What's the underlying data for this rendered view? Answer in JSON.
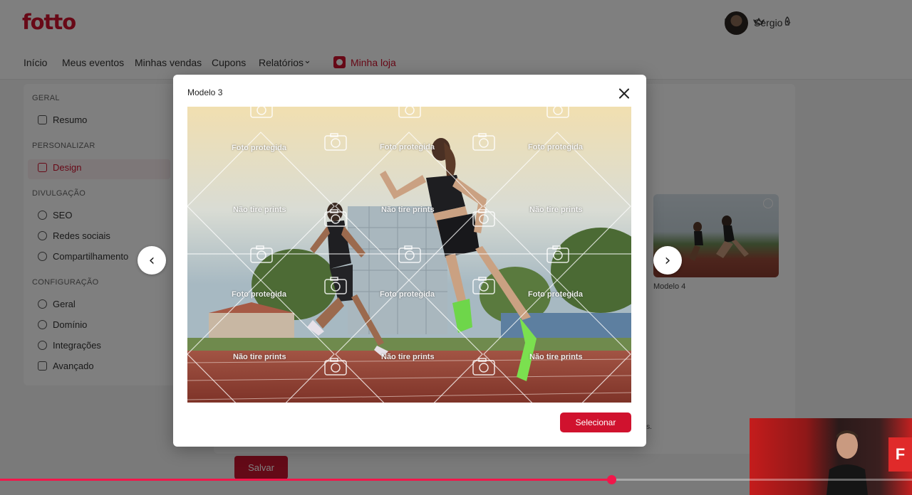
{
  "app": {
    "logo": "fotto",
    "user_name": "Sergio"
  },
  "nav": {
    "items": [
      "Início",
      "Meus eventos",
      "Minhas vendas",
      "Cupons",
      "Relatórios"
    ],
    "store": "Minha loja"
  },
  "sidebar": {
    "sections": {
      "geral": "GERAL",
      "personalizar": "PERSONALIZAR",
      "divulgacao": "DIVULGAÇÃO",
      "configuracao": "CONFIGURAÇÃO"
    },
    "items": {
      "resumo": "Resumo",
      "design": "Design",
      "seo": "SEO",
      "redes": "Redes sociais",
      "compartilhamento": "Compartilhamento",
      "geral": "Geral",
      "dominio": "Domínio",
      "integracoes": "Integrações",
      "avancado": "Avançado"
    }
  },
  "content": {
    "thumb_label": "Modelo 4",
    "notice_fragment": "dos.",
    "save_label": "Salvar"
  },
  "modal": {
    "title": "Modelo 3",
    "select_label": "Selecionar",
    "watermark_protected": "Foto protegida",
    "watermark_no_prints": "Não tire prints"
  },
  "video": {
    "progress_fraction": 0.67
  },
  "colors": {
    "brand": "#d0122e",
    "progress": "#f2164a"
  }
}
